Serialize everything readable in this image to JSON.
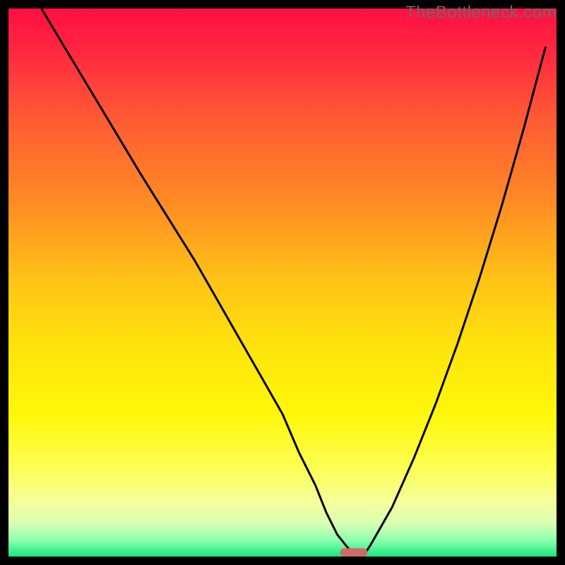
{
  "watermark": "TheBottleneck.com",
  "chart_data": {
    "type": "line",
    "title": "",
    "xlabel": "",
    "ylabel": "",
    "xlim": [
      0,
      100
    ],
    "ylim": [
      0,
      100
    ],
    "axes_visible": false,
    "grid": false,
    "background": {
      "type": "vertical-gradient",
      "stops": [
        {
          "offset": 0.0,
          "color": "#ff0f42"
        },
        {
          "offset": 0.08,
          "color": "#ff2840"
        },
        {
          "offset": 0.2,
          "color": "#ff5a34"
        },
        {
          "offset": 0.35,
          "color": "#ff8a24"
        },
        {
          "offset": 0.5,
          "color": "#ffc416"
        },
        {
          "offset": 0.62,
          "color": "#ffe40c"
        },
        {
          "offset": 0.74,
          "color": "#fff709"
        },
        {
          "offset": 0.84,
          "color": "#fdff55"
        },
        {
          "offset": 0.9,
          "color": "#f6ff9a"
        },
        {
          "offset": 0.94,
          "color": "#d9ffb2"
        },
        {
          "offset": 0.97,
          "color": "#8effb0"
        },
        {
          "offset": 1.0,
          "color": "#17e77e"
        }
      ]
    },
    "series": [
      {
        "name": "bottleneck-curve",
        "color": "#000000",
        "x": [
          6,
          12,
          18,
          24,
          29,
          34,
          38,
          42,
          46,
          50,
          53,
          56,
          58,
          60,
          62,
          63.5,
          65,
          66,
          70,
          74,
          78,
          82,
          86,
          90,
          94,
          98
        ],
        "y": [
          100,
          90,
          80,
          70,
          62,
          54,
          47,
          40,
          33,
          26,
          19,
          13,
          8,
          4,
          1.5,
          0.5,
          0.5,
          2,
          9,
          18,
          28,
          39,
          51,
          64,
          78,
          93
        ]
      }
    ],
    "marker": {
      "name": "optimal-point",
      "shape": "rounded-bar",
      "x": 63,
      "y": 0,
      "width_pct": 5,
      "height_pct": 1.5,
      "color": "#d06a6a"
    }
  }
}
